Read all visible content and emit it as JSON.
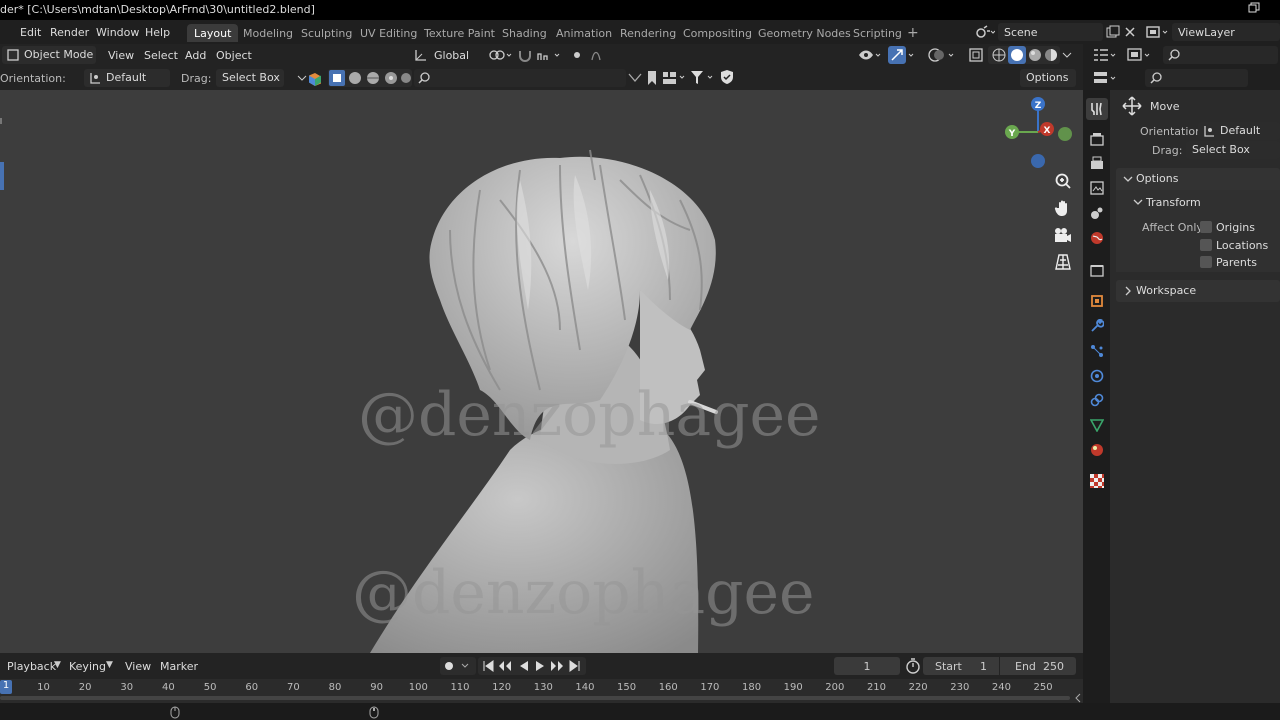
{
  "title": "der* [C:\\Users\\mdtan\\Desktop\\ArFrnd\\30\\untitled2.blend]",
  "menu": [
    "Edit",
    "Render",
    "Window",
    "Help"
  ],
  "workspaces": [
    {
      "label": "Layout",
      "active": true
    },
    {
      "label": "Modeling",
      "active": false
    },
    {
      "label": "Sculpting",
      "active": false
    },
    {
      "label": "UV Editing",
      "active": false
    },
    {
      "label": "Texture Paint",
      "active": false
    },
    {
      "label": "Shading",
      "active": false
    },
    {
      "label": "Animation",
      "active": false
    },
    {
      "label": "Rendering",
      "active": false
    },
    {
      "label": "Compositing",
      "active": false
    },
    {
      "label": "Geometry Nodes",
      "active": false
    },
    {
      "label": "Scripting",
      "active": false
    }
  ],
  "scene": {
    "name": "Scene",
    "view_layer": "ViewLayer"
  },
  "viewport_header": {
    "mode": "Object Mode",
    "menus": [
      "View",
      "Select",
      "Add",
      "Object"
    ],
    "transform_orientation": "Global",
    "options": "Options"
  },
  "tool_settings": {
    "orientation_label": "Orientation:",
    "orientation_value": "Default",
    "drag_label": "Drag:",
    "drag_value": "Select Box"
  },
  "watermark": [
    "@denzophagee",
    "@denzophagee"
  ],
  "gizmo": {
    "z": "Z",
    "y": "Y",
    "x": "X"
  },
  "properties": {
    "tool_name": "Move",
    "orientation_label": "Orientation",
    "orientation_value": "Default",
    "drag_label": "Drag:",
    "drag_value": "Select Box",
    "options_panel": "Options",
    "transform_panel": "Transform",
    "affect_only_label": "Affect Only",
    "affect_only": [
      "Origins",
      "Locations",
      "Parents"
    ],
    "workspace_panel": "Workspace"
  },
  "timeline": {
    "menus": [
      "Playback",
      "Keying",
      "View",
      "Marker"
    ],
    "current_frame": "1",
    "start_label": "Start",
    "start_value": "1",
    "end_label": "End",
    "end_value": "250",
    "ticks": [
      "1",
      "10",
      "20",
      "30",
      "40",
      "50",
      "60",
      "70",
      "80",
      "90",
      "100",
      "110",
      "120",
      "130",
      "140",
      "150",
      "160",
      "170",
      "180",
      "190",
      "200",
      "210",
      "220",
      "230",
      "240",
      "250"
    ]
  },
  "colors": {
    "accent": "#4772b3",
    "viewport_bg": "#3d3d3d",
    "model": "#bdbdbd"
  }
}
